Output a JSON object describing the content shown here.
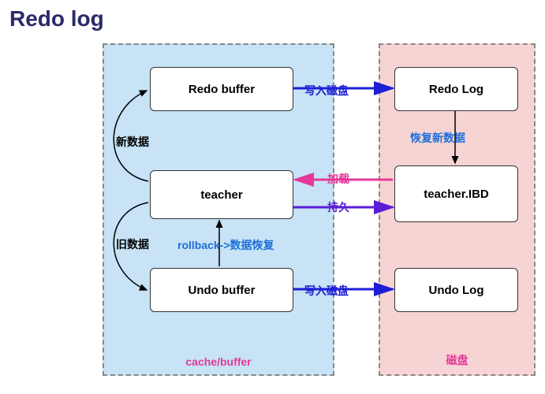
{
  "title": "Redo log",
  "zones": {
    "cache_label": "cache/buffer",
    "disk_label": "磁盘"
  },
  "boxes": {
    "redo_buffer": "Redo buffer",
    "teacher": "teacher",
    "undo_buffer": "Undo buffer",
    "redo_log": "Redo Log",
    "teacher_ibd": "teacher.IBD",
    "undo_log": "Undo Log"
  },
  "labels": {
    "new_data": "新数据",
    "old_data": "旧数据",
    "rollback": "rollback->数据恢复",
    "restore_new": "恢复新数据",
    "write_disk1": "写入磁盘",
    "write_disk2": "写入磁盘",
    "load": "加载",
    "persist": "持久"
  }
}
